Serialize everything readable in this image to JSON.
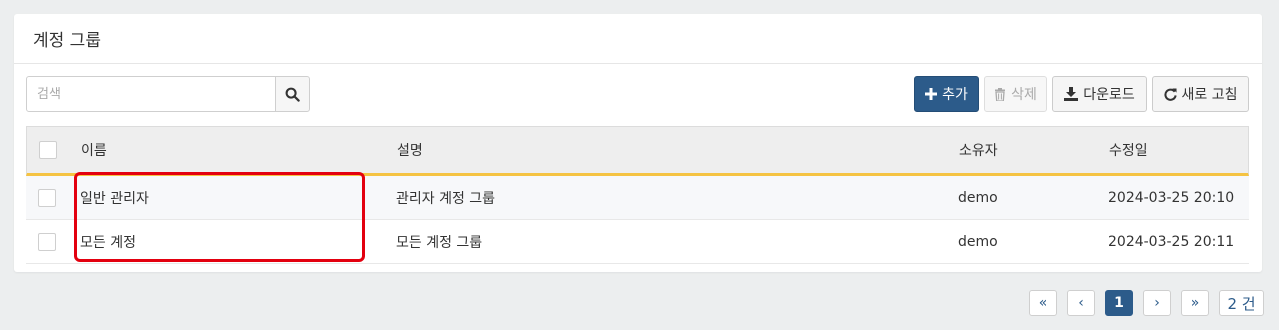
{
  "panel": {
    "title": "계정 그룹"
  },
  "search": {
    "placeholder": "검색",
    "value": ""
  },
  "toolbar": {
    "add_label": "추가",
    "delete_label": "삭제",
    "download_label": "다운로드",
    "refresh_label": "새로 고침"
  },
  "table": {
    "columns": [
      "이름",
      "설명",
      "소유자",
      "수정일"
    ],
    "rows": [
      {
        "name": "일반 관리자",
        "description": "관리자 계정 그룹",
        "owner": "demo",
        "modified": "2024-03-25 20:10"
      },
      {
        "name": "모든 계정",
        "description": "모든 계정 그룹",
        "owner": "demo",
        "modified": "2024-03-25 20:11"
      }
    ]
  },
  "pagination": {
    "first": "«",
    "prev": "‹",
    "current_page": "1",
    "next": "›",
    "last": "»",
    "total_label": "2 건"
  },
  "colors": {
    "accent": "#2c5b8a",
    "header_underline": "#f5c342",
    "highlight": "#e3000f"
  }
}
